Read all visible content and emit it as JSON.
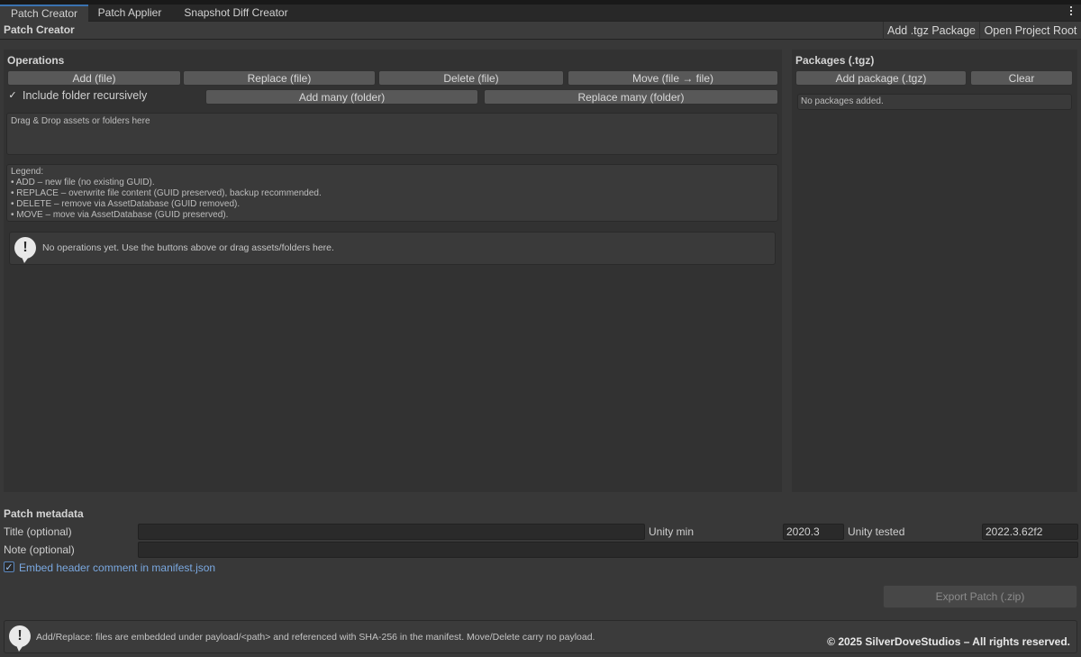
{
  "tabs": [
    {
      "label": "Patch Creator",
      "active": true
    },
    {
      "label": "Patch Applier",
      "active": false
    },
    {
      "label": "Snapshot Diff Creator",
      "active": false
    }
  ],
  "toolbar": {
    "title": "Patch Creator",
    "add_tgz_label": "Add .tgz Package",
    "open_root_label": "Open Project Root"
  },
  "operations": {
    "title": "Operations",
    "add_file": "Add (file)",
    "replace_file": "Replace (file)",
    "delete_file": "Delete (file)",
    "move_file": "Move (file → file)",
    "include_recursive_label": "Include folder recursively",
    "include_recursive_checked": true,
    "add_many": "Add many (folder)",
    "replace_many": "Replace many (folder)",
    "dropzone_text": "Drag & Drop assets or folders here",
    "legend": {
      "title": "Legend:",
      "lines": [
        "• ADD – new file (no existing GUID).",
        "• REPLACE – overwrite file content (GUID preserved), backup recommended.",
        "• DELETE – remove via AssetDatabase (GUID removed).",
        "• MOVE – move via AssetDatabase (GUID preserved)."
      ]
    },
    "empty_message": "No operations yet. Use the buttons above or drag assets/folders here."
  },
  "packages": {
    "title": "Packages (.tgz)",
    "add_package": "Add package (.tgz)",
    "clear": "Clear",
    "empty_message": "No packages added."
  },
  "metadata": {
    "title": "Patch metadata",
    "title_label": "Title (optional)",
    "title_value": "",
    "unity_min_label": "Unity min",
    "unity_min_value": "2020.3",
    "unity_tested_label": "Unity tested",
    "unity_tested_value": "2022.3.62f2",
    "note_label": "Note (optional)",
    "note_value": "",
    "embed_label": "Embed header comment in manifest.json",
    "embed_checked": true
  },
  "export_label": "Export Patch (.zip)",
  "footer": {
    "info": "Add/Replace: files are embedded under payload/<path> and referenced with SHA-256 in the manifest. Move/Delete carry no payload.",
    "copyright": "© 2025 SilverDoveStudios – All rights reserved."
  },
  "colors": {
    "accent": "#3a72b0",
    "link": "#7aa8e0",
    "background": "#383838",
    "panel": "#323232"
  }
}
